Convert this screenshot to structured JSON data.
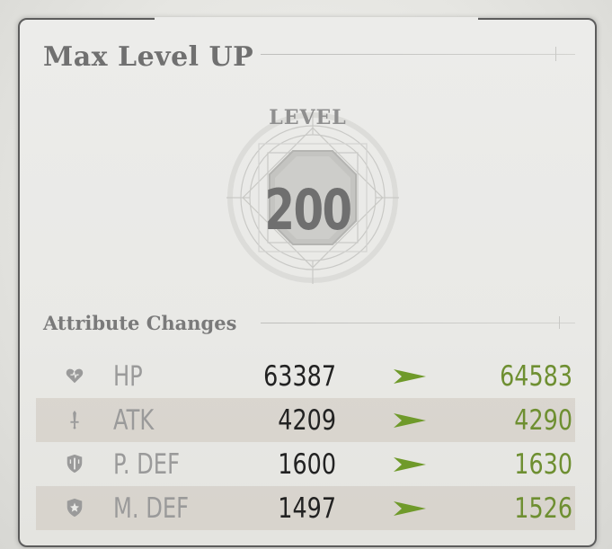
{
  "dialog": {
    "title": "Max Level UP"
  },
  "level": {
    "label": "LEVEL",
    "value": "200"
  },
  "attributes": {
    "section_title": "Attribute Changes",
    "items": [
      {
        "name": "HP",
        "old": "63387",
        "new": "64583",
        "icon": "heart-icon"
      },
      {
        "name": "ATK",
        "old": "4209",
        "new": "4290",
        "icon": "sword-icon"
      },
      {
        "name": "P. DEF",
        "old": "1600",
        "new": "1630",
        "icon": "shield-icon"
      },
      {
        "name": "M. DEF",
        "old": "1497",
        "new": "1526",
        "icon": "magic-shield-icon"
      }
    ]
  },
  "colors": {
    "increase": "#6e8f31",
    "arrow": "#6f9a2a",
    "title": "#707070"
  }
}
